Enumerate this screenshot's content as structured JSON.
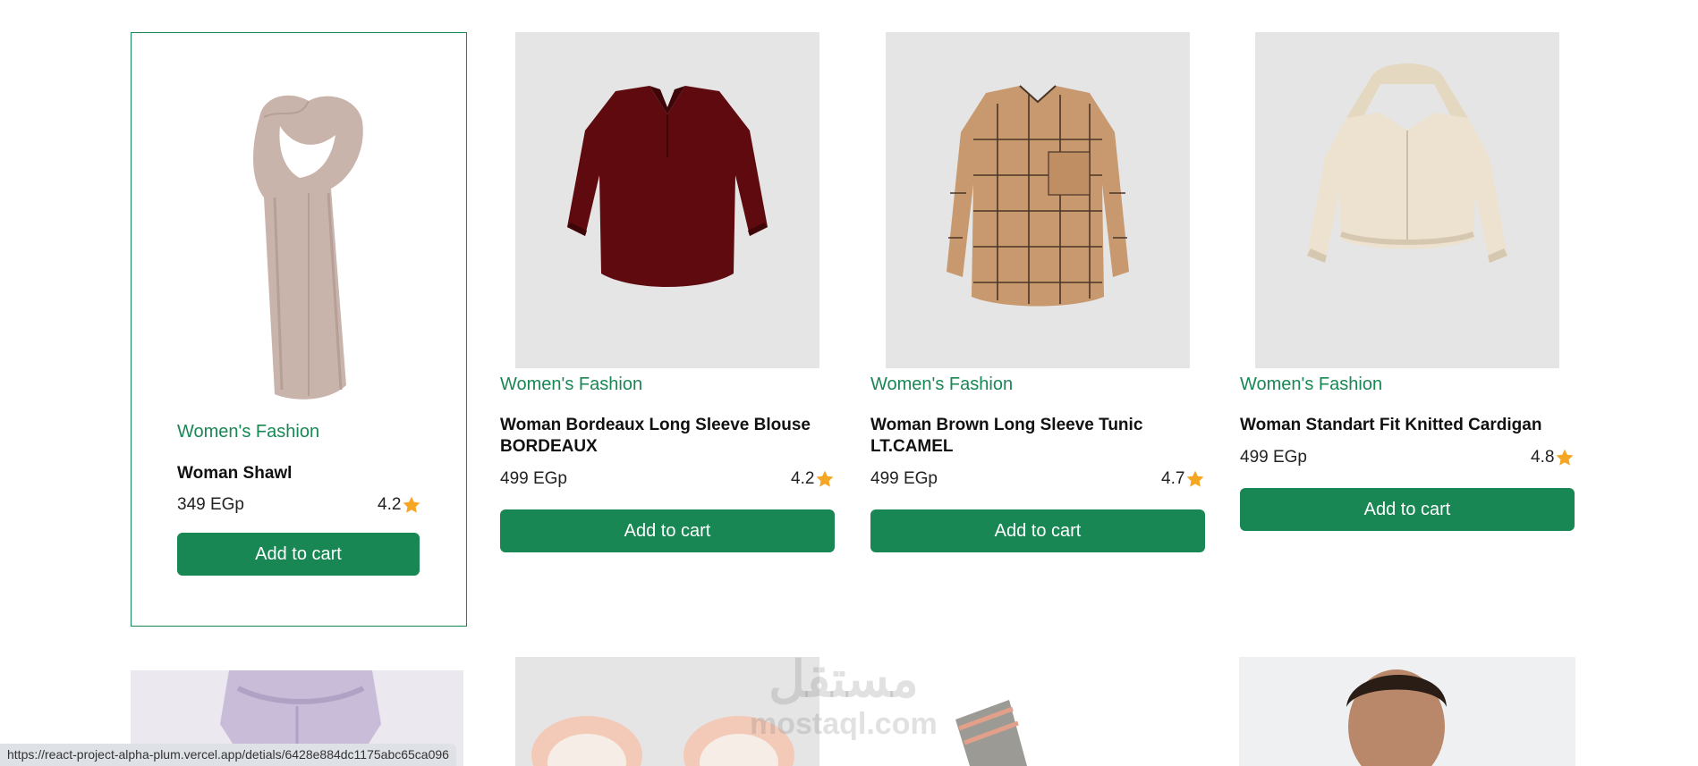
{
  "products": [
    {
      "category": "Women's Fashion",
      "title": "Woman Shawl",
      "price": "349 EGp",
      "rating": "4.2",
      "button": "Add to cart",
      "image_icon": "shawl-image"
    },
    {
      "category": "Women's Fashion",
      "title": "Woman Bordeaux Long Sleeve Blouse BORDEAUX",
      "price": "499 EGp",
      "rating": "4.2",
      "button": "Add to cart",
      "image_icon": "blouse-image"
    },
    {
      "category": "Women's Fashion",
      "title": "Woman Brown Long Sleeve Tunic LT.CAMEL",
      "price": "499 EGp",
      "rating": "4.7",
      "button": "Add to cart",
      "image_icon": "tunic-image"
    },
    {
      "category": "Women's Fashion",
      "title": "Woman Standart Fit Knitted Cardigan",
      "price": "499 EGp",
      "rating": "4.8",
      "button": "Add to cart",
      "image_icon": "cardigan-image"
    }
  ],
  "second_row_images": [
    "lilac-outfit-image",
    "slippers-image",
    "socks-image",
    "man-portrait-image"
  ],
  "status_url": "https://react-project-alpha-plum.vercel.app/detials/6428e884dc1175abc65ca096",
  "watermark": {
    "main": "مستقل",
    "sub": "mostaql.com"
  },
  "colors": {
    "accent": "#198754",
    "star": "#f5a623",
    "image_bg": "#e5e5e5",
    "blouse": "#5e0a0e",
    "shawl": "#c9b4ac",
    "tunic": "#c8996e",
    "cardigan": "#ede2cf"
  }
}
